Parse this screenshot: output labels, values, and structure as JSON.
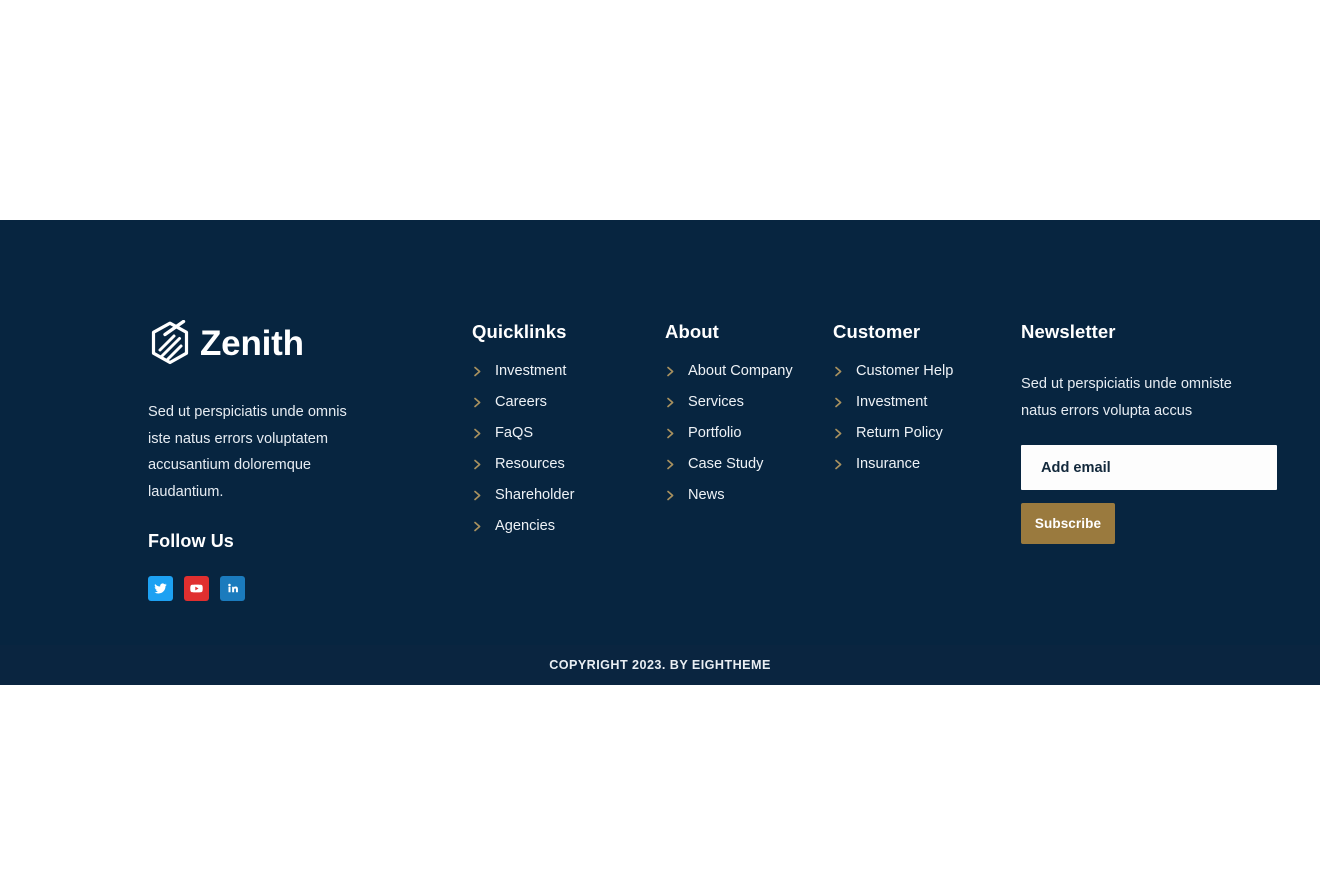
{
  "theme": {
    "footer_bg": "#072540",
    "copyright_bg": "#0a2540",
    "accent_gold": "#9a7a3e",
    "chevron_color": "#a8915f",
    "text_light": "#e6ecf2",
    "page_bg": "#ffffff"
  },
  "brand": {
    "logo_icon": "zenith-hexagon-logo-icon",
    "name": "Zenith",
    "description": "Sed ut perspiciatis unde omnis iste natus errors voluptatem accusantium doloremque laudantium.",
    "follow_title": "Follow Us",
    "socials": [
      {
        "name": "twitter",
        "icon": "twitter-icon",
        "label": "Twitter",
        "color": "#1da1f2"
      },
      {
        "name": "youtube",
        "icon": "youtube-icon",
        "label": "YouTube",
        "color": "#e02f2f"
      },
      {
        "name": "linkedin",
        "icon": "linkedin-icon",
        "label": "LinkedIn",
        "color": "#1b7bbd"
      }
    ]
  },
  "columns": [
    {
      "id": "quicklinks",
      "title": "Quicklinks",
      "links": [
        "Investment",
        "Careers",
        "FaQS",
        "Resources",
        "Shareholder",
        "Agencies"
      ]
    },
    {
      "id": "about",
      "title": "About",
      "links": [
        "About Company",
        "Services",
        "Portfolio",
        "Case Study",
        "News"
      ]
    },
    {
      "id": "customer",
      "title": "Customer",
      "links": [
        "Customer Help",
        "Investment",
        "Return Policy",
        "Insurance"
      ]
    }
  ],
  "newsletter": {
    "title": "Newsletter",
    "description": "Sed ut perspiciatis unde omniste natus errors volupta accus",
    "email_placeholder": "Add email",
    "email_value": "",
    "subscribe_label": "Subscribe"
  },
  "copyright": {
    "text": "COPYRIGHT 2023. BY EIGHTHEME"
  }
}
